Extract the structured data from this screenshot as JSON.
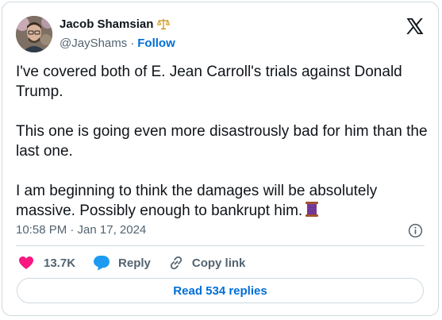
{
  "author": {
    "name": "Jacob Shamsian",
    "handle": "@JayShams",
    "separator": "·",
    "follow_label": "Follow",
    "badge_icon": "scales-icon",
    "avatar_icon": "avatar-photo"
  },
  "brand_icon": "x-logo-icon",
  "post": {
    "paragraphs": [
      "I've covered both of E. Jean Carroll's trials against Donald Trump.",
      "This one is going even more disastrously bad for him than the last one.",
      "I am beginning to think the damages will be absolutely massive. Possibly enough to bankrupt him."
    ],
    "emoji_icon": "thread-spool-icon",
    "timestamp": "10:58 PM · Jan 17, 2024"
  },
  "actions": {
    "likes": "13.7K",
    "reply_label": "Reply",
    "copy_link_label": "Copy link"
  },
  "read_replies_label": "Read 534 replies",
  "colors": {
    "link": "#006fd6",
    "heart": "#f91880",
    "reply_bubble": "#1d9bf0",
    "text": "#0f1419",
    "muted": "#536471",
    "border": "#cfd9de"
  }
}
